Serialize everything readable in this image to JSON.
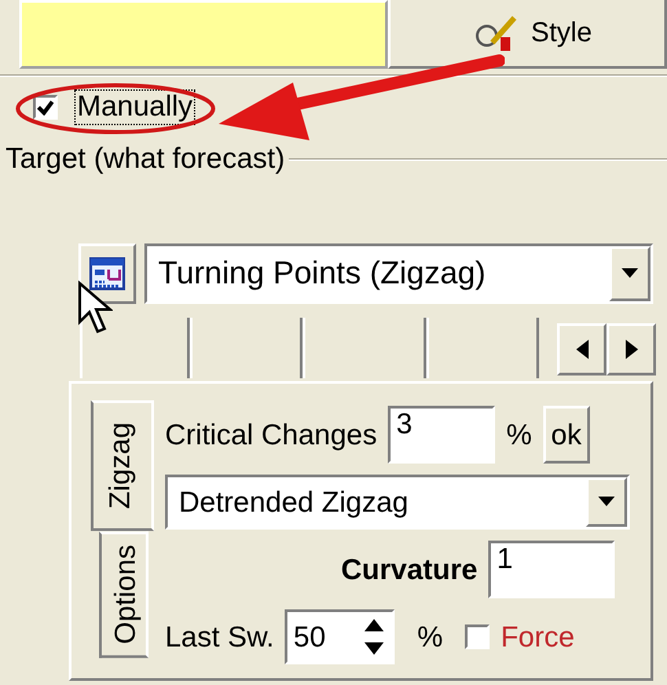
{
  "top_panel": {
    "style_button": "Style"
  },
  "manually": {
    "label": "Manually",
    "checked": true
  },
  "target_group": {
    "title": "Target (what forecast)",
    "target_combo": "Turning Points (Zigzag)",
    "side_tabs": [
      {
        "label": "Zigzag",
        "selected": true
      },
      {
        "label": "Options",
        "selected": false
      }
    ],
    "critical_changes": {
      "label": "Critical Changes",
      "value": "3",
      "unit": "%",
      "button": "ok"
    },
    "method_combo": "Detrended Zigzag",
    "curvature": {
      "label": "Curvature",
      "value": "1"
    },
    "last_sw": {
      "label": "Last Sw.",
      "value": "50",
      "unit": "%"
    },
    "force": {
      "label": "Force",
      "checked": false
    }
  }
}
